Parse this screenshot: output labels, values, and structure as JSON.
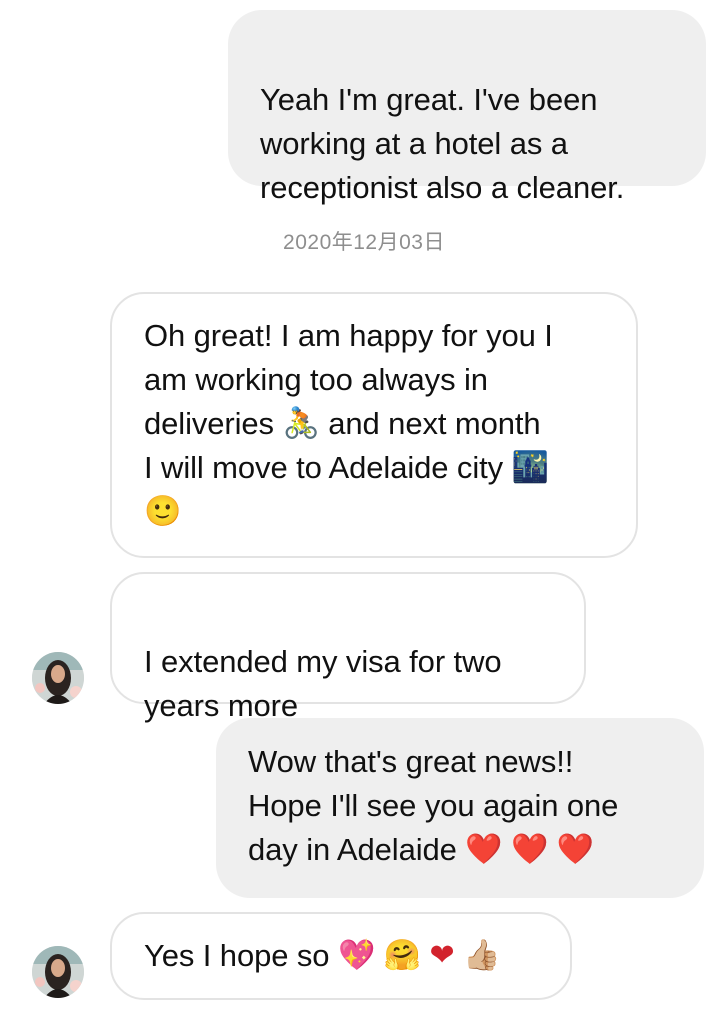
{
  "conversation": {
    "messages": [
      {
        "direction": "outgoing",
        "text": "Yeah I'm great. I've been\nworking at a hotel as a\nreceptionist also a cleaner."
      },
      {
        "type": "timestamp",
        "text": "2020年12月03日"
      },
      {
        "direction": "incoming",
        "text_lines": [
          "Oh great! I am happy for you I",
          "am working too always in",
          "deliveries",
          "and next month",
          "I will move to Adelaide city"
        ],
        "emojis": {
          "bicycle": "🚴",
          "city_night": "🌃",
          "smile": "🙂"
        }
      },
      {
        "direction": "incoming",
        "text": "I extended my visa for two\nyears more"
      },
      {
        "direction": "outgoing",
        "text_lines": [
          "Wow that's great news!!",
          "Hope I'll see you again one",
          "day in Adelaide"
        ],
        "emojis": [
          "❤️",
          "❤️",
          "❤️"
        ]
      },
      {
        "direction": "incoming",
        "text": "Yes I hope so",
        "emojis": [
          "💖",
          "🤗",
          "❤",
          "👍🏼"
        ]
      }
    ]
  },
  "colors": {
    "outgoing_bubble": "#efefef",
    "incoming_border": "#e3e3e3",
    "timestamp": "#8e8e8e",
    "text": "#111111",
    "heart": "#e0242d"
  }
}
